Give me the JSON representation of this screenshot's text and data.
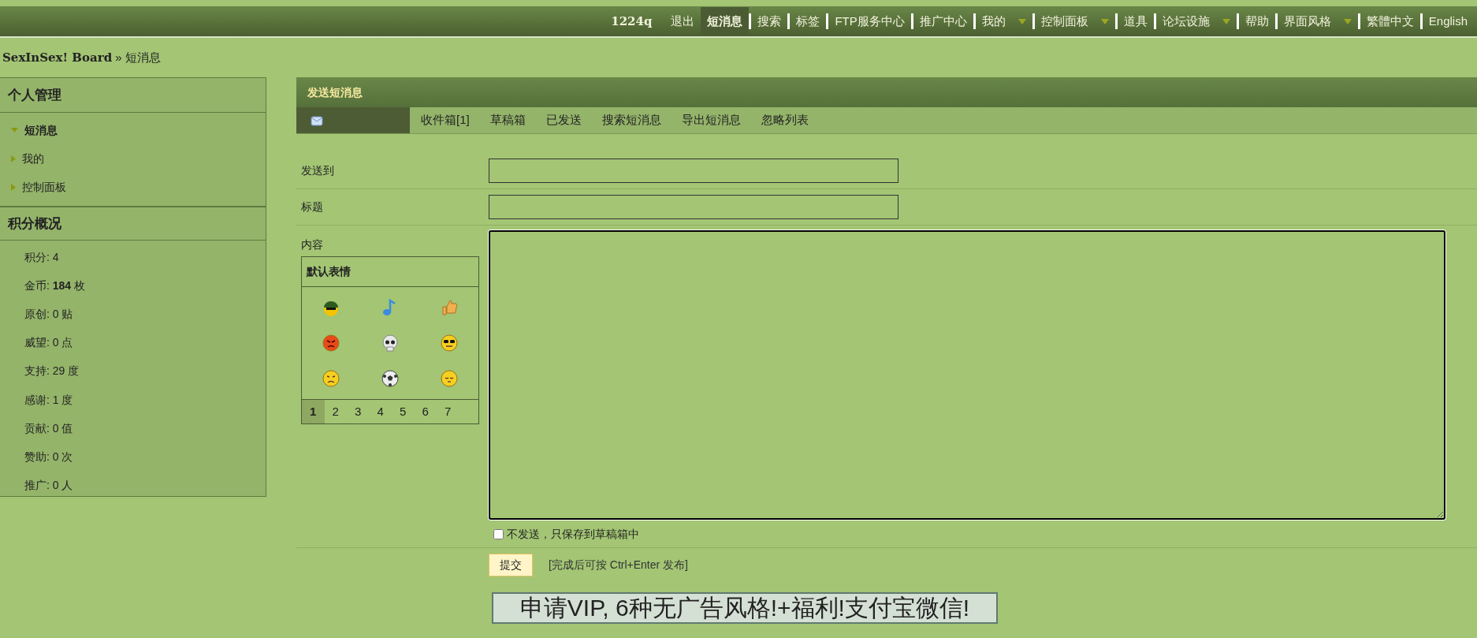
{
  "top_nav": {
    "user": "1224q",
    "items": [
      {
        "label": "退出",
        "selected": false,
        "dropdown": false
      },
      {
        "label": "短消息",
        "selected": true,
        "dropdown": false
      },
      {
        "label": "搜索",
        "selected": false,
        "dropdown": false
      },
      {
        "label": "标签",
        "selected": false,
        "dropdown": false
      },
      {
        "label": "FTP服务中心",
        "selected": false,
        "dropdown": false
      },
      {
        "label": "推广中心",
        "selected": false,
        "dropdown": false
      },
      {
        "label": "我的",
        "selected": false,
        "dropdown": true
      },
      {
        "label": "控制面板",
        "selected": false,
        "dropdown": true
      },
      {
        "label": "道具",
        "selected": false,
        "dropdown": false
      },
      {
        "label": "论坛设施",
        "selected": false,
        "dropdown": true
      },
      {
        "label": "帮助",
        "selected": false,
        "dropdown": false
      },
      {
        "label": "界面风格",
        "selected": false,
        "dropdown": true
      },
      {
        "label": "繁體中文",
        "selected": false,
        "dropdown": false
      },
      {
        "label": "English",
        "selected": false,
        "dropdown": false
      }
    ]
  },
  "breadcrumb": {
    "site": "SexInSex! Board",
    "separator": "»",
    "page": "短消息"
  },
  "sidebar": {
    "title": "个人管理",
    "items": [
      {
        "label": "短消息",
        "selected": true
      },
      {
        "label": "我的",
        "selected": false
      },
      {
        "label": "控制面板",
        "selected": false
      }
    ],
    "stats_title": "积分概况",
    "stats": [
      "积分: 4",
      "金币: **184** 枚",
      "原创: 0 贴",
      "威望: 0 点",
      "支持: 29 度",
      "感谢: 1 度",
      "贡献: 0 值",
      "赞助: 0 次",
      "推广: 0 人"
    ]
  },
  "panel": {
    "title": "发送短消息",
    "tabs": [
      {
        "label": "收件箱[1]",
        "selected": false
      },
      {
        "label": "草稿箱",
        "selected": false
      },
      {
        "label": "已发送",
        "selected": false
      },
      {
        "label": "搜索短消息",
        "selected": false
      },
      {
        "label": "导出短消息",
        "selected": false
      },
      {
        "label": "忽略列表",
        "selected": false
      }
    ],
    "fields": [
      {
        "label": "发送到"
      },
      {
        "label": "标题"
      }
    ],
    "content_label": "内容",
    "smilies": {
      "title": "默认表情",
      "pages": [
        {
          "label": "1",
          "selected": true
        },
        {
          "label": "2",
          "selected": false
        },
        {
          "label": "3",
          "selected": false
        },
        {
          "label": "4",
          "selected": false
        },
        {
          "label": "5",
          "selected": false
        },
        {
          "label": "6",
          "selected": false
        },
        {
          "label": "7",
          "selected": false
        }
      ]
    },
    "draft_only": {
      "label": "不发送，只保存到草稿箱中",
      "checked": false
    },
    "submit": "提交",
    "hint": "[完成后可按 Ctrl+Enter 发布]"
  },
  "banner": "申请VIP, 6种无广告风格!+福利!支付宝微信!"
}
